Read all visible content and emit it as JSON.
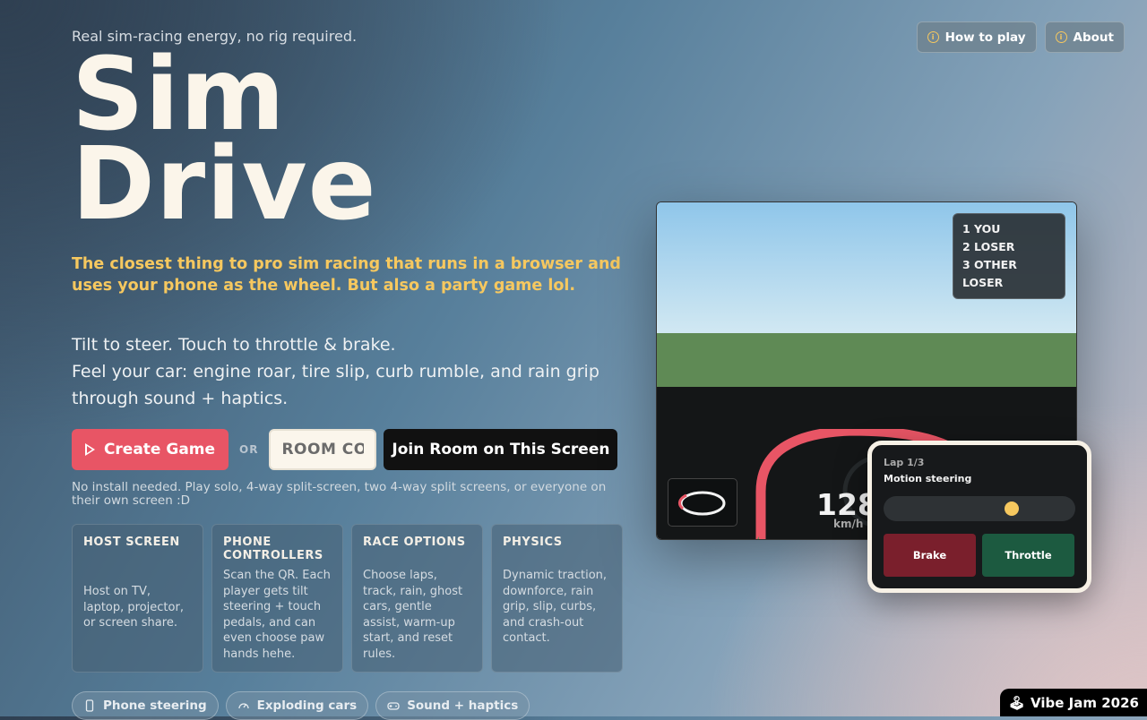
{
  "tagline": "Real sim-racing energy, no rig required.",
  "nav": {
    "how_to_play": "How to play",
    "about": "About"
  },
  "title": {
    "line1": "Sim",
    "line2": "Drive"
  },
  "lead": "The closest thing to pro sim racing that runs in a browser and uses your phone as the wheel. But also a party game lol.",
  "desc": {
    "line1": "Tilt to steer. Touch to throttle & brake.",
    "line2": "Feel your car: engine roar, tire slip, curb rumble, and rain grip through sound + haptics."
  },
  "actions": {
    "create_label": "Create Game",
    "or_label": "OR",
    "room_placeholder": "ROOM CODE",
    "join_label": "Join Room on This Screen"
  },
  "note": "No install needed. Play solo, 4-way split-screen, two 4-way split screens, or everyone on their own screen :D",
  "cards": [
    {
      "title": "HOST SCREEN",
      "body": "Host on TV, laptop, projector, or screen share."
    },
    {
      "title": "PHONE CONTROLLERS",
      "body": "Scan the QR. Each player gets tilt steering + touch pedals, and can even choose paw hands hehe."
    },
    {
      "title": "RACE OPTIONS",
      "body": "Choose laps, track, rain, ghost cars, gentle assist, warm-up start, and reset rules."
    },
    {
      "title": "PHYSICS",
      "body": "Dynamic traction, downforce, rain grip, slip, curbs, and crash-out contact."
    }
  ],
  "chips": [
    {
      "label": "Phone steering",
      "icon": "phone-icon"
    },
    {
      "label": "Exploding cars",
      "icon": "gauge-icon"
    },
    {
      "label": "Sound + haptics",
      "icon": "gamepad-icon"
    }
  ],
  "preview": {
    "standings": [
      "1 YOU",
      "2 LOSER",
      "3 OTHER LOSER"
    ],
    "speed": "128",
    "speed_unit": "km/h"
  },
  "phone": {
    "lap": "Lap 1/3",
    "mode": "Motion steering",
    "steer_level": 0.68,
    "brake_label": "Brake",
    "throttle_label": "Throttle"
  },
  "jam_badge": "Vibe Jam 2026",
  "colors": {
    "accent_red": "#e85565",
    "accent_yellow": "#f6c85f",
    "title_cream": "#fbf5ea",
    "brake": "#7a1f2c",
    "throttle": "#1c5a40"
  }
}
